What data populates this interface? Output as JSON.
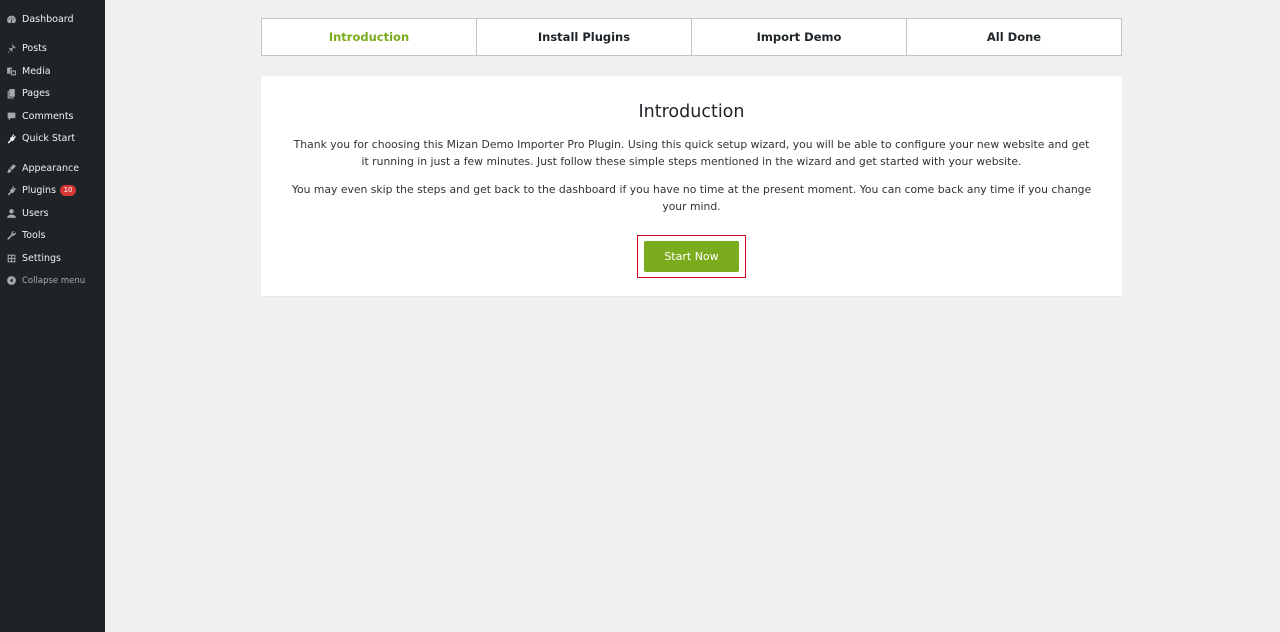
{
  "sidebar": {
    "items": [
      {
        "label": "Dashboard",
        "icon": "dashboard-icon"
      },
      {
        "label": "Posts",
        "icon": "pin-icon"
      },
      {
        "label": "Media",
        "icon": "media-icon"
      },
      {
        "label": "Pages",
        "icon": "pages-icon"
      },
      {
        "label": "Comments",
        "icon": "comments-icon"
      },
      {
        "label": "Quick Start",
        "icon": "plug-icon"
      },
      {
        "label": "Appearance",
        "icon": "brush-icon"
      },
      {
        "label": "Plugins",
        "icon": "plugins-icon",
        "badge": "10"
      },
      {
        "label": "Users",
        "icon": "users-icon"
      },
      {
        "label": "Tools",
        "icon": "wrench-icon"
      },
      {
        "label": "Settings",
        "icon": "settings-icon"
      },
      {
        "label": "Collapse menu",
        "icon": "collapse-icon"
      }
    ]
  },
  "steps": [
    {
      "label": "Introduction",
      "active": true
    },
    {
      "label": "Install Plugins",
      "active": false
    },
    {
      "label": "Import Demo",
      "active": false
    },
    {
      "label": "All Done",
      "active": false
    }
  ],
  "card": {
    "title": "Introduction",
    "paragraph1": "Thank you for choosing this Mizan Demo Importer Pro Plugin. Using this quick setup wizard, you will be able to configure your new website and get it running in just a few minutes. Just follow these simple steps mentioned in the wizard and get started with your website.",
    "paragraph2": "You may even skip the steps and get back to the dashboard if you have no time at the present moment. You can come back any time if you change your mind.",
    "button_label": "Start Now"
  },
  "colors": {
    "sidebar_bg": "#1d2327",
    "accent": "#7aac1d",
    "highlight": "#d0021b",
    "badge": "#d63638"
  }
}
